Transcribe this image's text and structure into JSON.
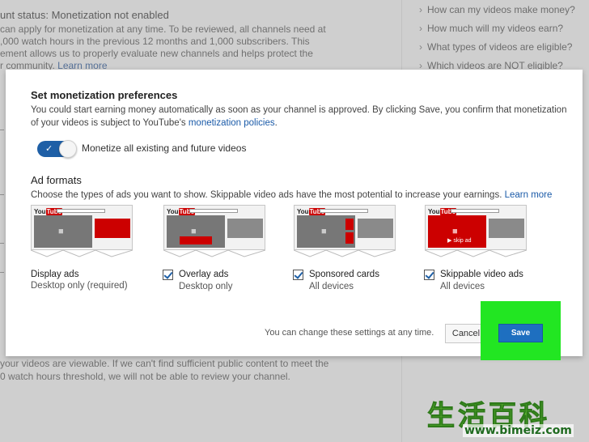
{
  "background": {
    "status_lines": [
      "unt status: Monetization not enabled",
      "can apply for monetization at any time. To be reviewed, all channels need at",
      ",000 watch hours in the previous 12 months and 1,000 subscribers. This",
      "ement allows us to properly evaluate new channels and helps protect the",
      "r community."
    ],
    "learn_more": "Learn more",
    "faq": [
      "How can my videos make money?",
      "How much will my videos earn?",
      "What types of videos are eligible?",
      "Which videos are NOT eligible?"
    ],
    "bottom_lines": [
      "your videos are viewable. If we can't find sufficient public content to meet the",
      "0 watch hours threshold, we will not be able to review your channel."
    ]
  },
  "dialog": {
    "monetization": {
      "title": "Set monetization preferences",
      "text_line1": "You could start earning money automatically as soon as your channel is approved. By clicking Save, you confirm that monetization",
      "text_line2_prefix": "of your videos is subject to YouTube's ",
      "policies_link": "monetization policies",
      "text_line2_suffix": ".",
      "toggle_label": "Monetize all existing and future videos",
      "toggle_on": true
    },
    "ad_formats": {
      "title": "Ad formats",
      "text": "Choose the types of ads you want to show. Skippable video ads have the most potential to increase your earnings. ",
      "learn_more": "Learn more",
      "thumb_brand": "You",
      "thumb_brand_tube": "Tube",
      "skip_label": "▶ skip ad",
      "items": [
        {
          "label": "Display ads",
          "sub": "Desktop only (required)",
          "checked": true
        },
        {
          "label": "Overlay ads",
          "sub": "Desktop only",
          "checked": true
        },
        {
          "label": "Sponsored cards",
          "sub": "All devices",
          "checked": true
        },
        {
          "label": "Skippable video ads",
          "sub": "All devices",
          "checked": true
        }
      ]
    },
    "footer_note": "You can change these settings at any time.",
    "cancel_label": "Cancel",
    "save_label": "Save"
  },
  "watermark": {
    "chars": "生活百科",
    "url": "www.bimeiz.com"
  },
  "colors": {
    "accent": "#1e5fa6",
    "highlight": "#22e622",
    "ad_red": "#cc0000"
  }
}
